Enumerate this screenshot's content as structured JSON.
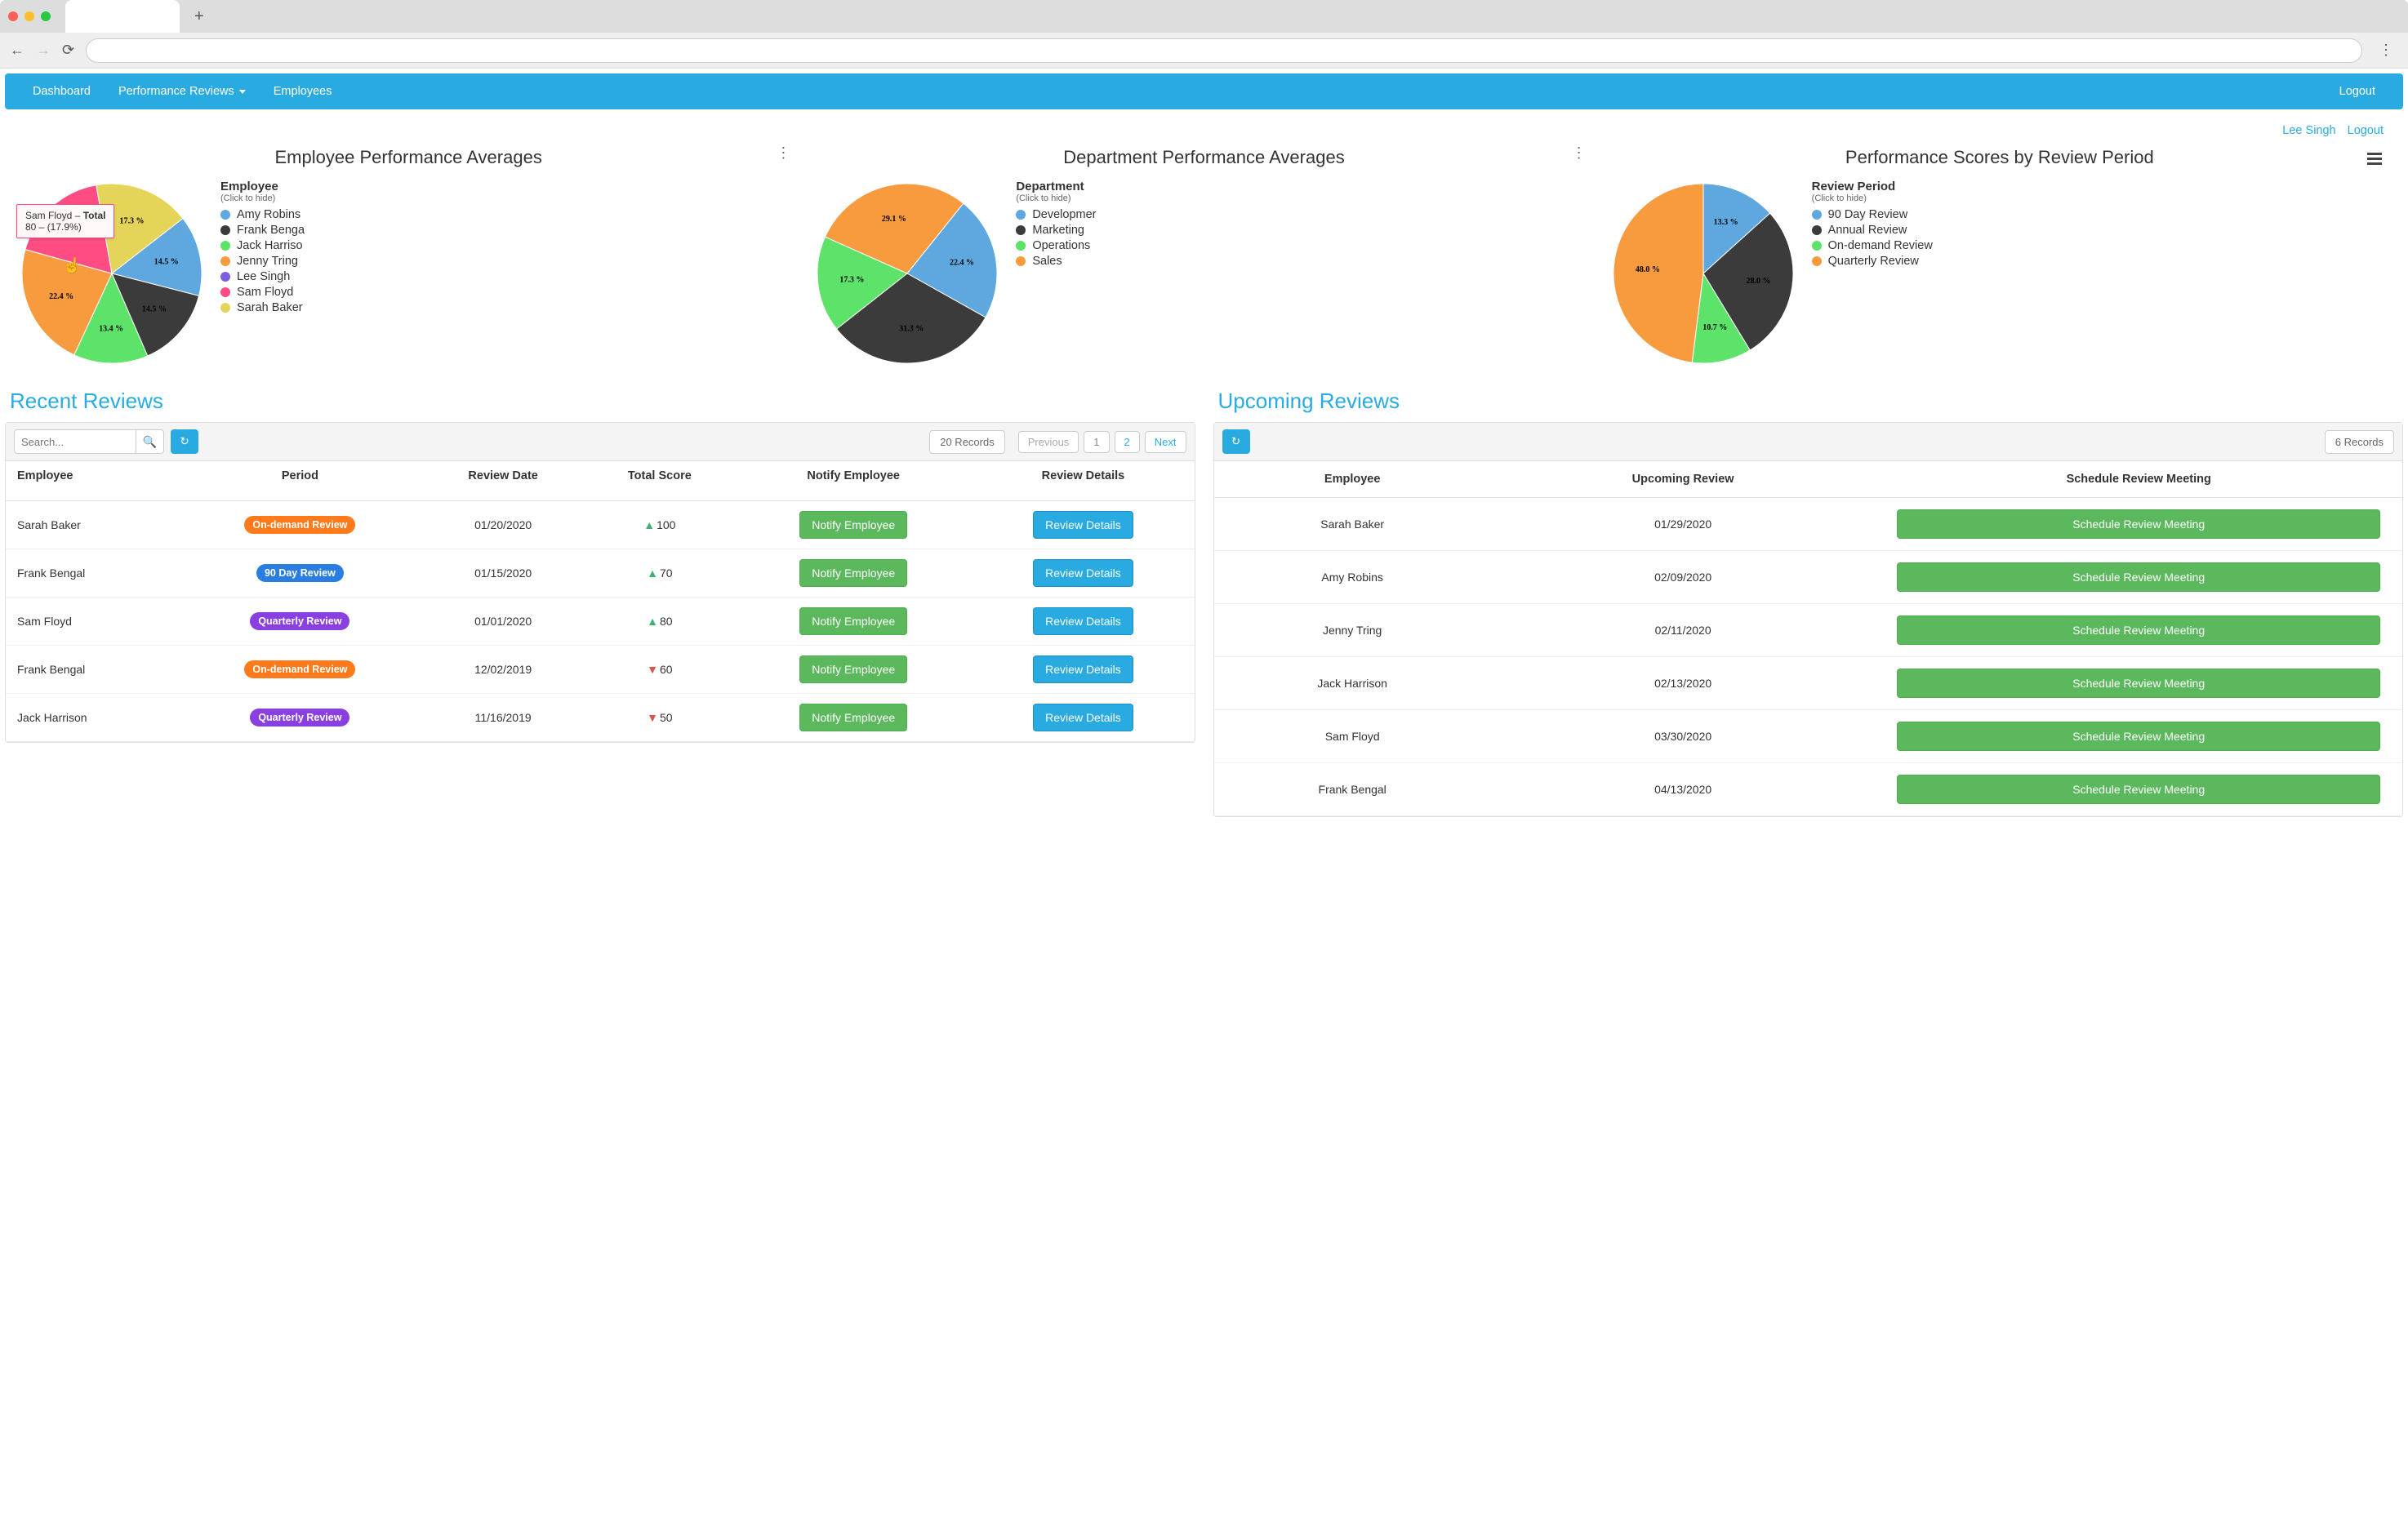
{
  "nav": {
    "items": [
      "Dashboard",
      "Performance Reviews",
      "Employees"
    ],
    "logout": "Logout"
  },
  "topLinks": {
    "user": "Lee Singh",
    "logout": "Logout"
  },
  "charts": [
    {
      "title": "Employee Performance Averages",
      "legendTitle": "Employee",
      "legendSub": "(Click to hide)",
      "tooltip": {
        "name": "Sam Floyd",
        "label": "Total",
        "value": "80 – (17.9%)"
      }
    },
    {
      "title": "Department Performance Averages",
      "legendTitle": "Department",
      "legendSub": "(Click to hide)"
    },
    {
      "title": "Performance Scores by Review Period",
      "legendTitle": "Review Period",
      "legendSub": "(Click to hide)"
    }
  ],
  "chart_data": [
    {
      "type": "pie",
      "title": "Employee Performance Averages",
      "series": [
        {
          "name": "Amy Robins",
          "value": 14.5,
          "color": "#5ea8df"
        },
        {
          "name": "Frank Benga",
          "value": 14.5,
          "color": "#3b3b3b"
        },
        {
          "name": "Jack Harriso",
          "value": 13.4,
          "color": "#5de26a"
        },
        {
          "name": "Jenny Tring",
          "value": 22.4,
          "color": "#f89b3f"
        },
        {
          "name": "Lee Singh",
          "value": 0.0,
          "color": "#7c5fe0"
        },
        {
          "name": "Sam Floyd",
          "value": 17.9,
          "color": "#ff4d84"
        },
        {
          "name": "Sarah Baker",
          "value": 17.3,
          "color": "#e5d45a"
        }
      ]
    },
    {
      "type": "pie",
      "title": "Department Performance Averages",
      "series": [
        {
          "name": "Developmer",
          "value": 22.4,
          "color": "#5ea8df"
        },
        {
          "name": "Marketing",
          "value": 31.3,
          "color": "#3b3b3b"
        },
        {
          "name": "Operations",
          "value": 17.3,
          "color": "#5de26a"
        },
        {
          "name": "Sales",
          "value": 29.1,
          "color": "#f89b3f"
        }
      ]
    },
    {
      "type": "pie",
      "title": "Performance Scores by Review Period",
      "series": [
        {
          "name": "90 Day Review",
          "value": 13.3,
          "color": "#5ea8df"
        },
        {
          "name": "Annual Review",
          "value": 28.0,
          "color": "#3b3b3b"
        },
        {
          "name": "On-demand Review",
          "value": 10.7,
          "color": "#5de26a"
        },
        {
          "name": "Quarterly Review",
          "value": 48.0,
          "color": "#f89b3f"
        }
      ]
    }
  ],
  "recent": {
    "title": "Recent Reviews",
    "searchPlaceholder": "Search...",
    "recordsLabel": "20 Records",
    "pager": {
      "prev": "Previous",
      "pages": [
        "1",
        "2"
      ],
      "next": "Next",
      "active": 0
    },
    "headers": [
      "Employee",
      "Period",
      "Review Date",
      "Total Score",
      "Notify Employee",
      "Review Details"
    ],
    "notifyLabel": "Notify Employee",
    "detailsLabel": "Review Details",
    "pillColors": {
      "On-demand Review": "#ff7a1a",
      "90 Day Review": "#2a7de1",
      "Quarterly Review": "#8a3fe0"
    },
    "rows": [
      {
        "employee": "Sarah Baker",
        "period": "On-demand Review",
        "date": "01/20/2020",
        "score": 100,
        "dir": "up"
      },
      {
        "employee": "Frank Bengal",
        "period": "90 Day Review",
        "date": "01/15/2020",
        "score": 70,
        "dir": "up"
      },
      {
        "employee": "Sam Floyd",
        "period": "Quarterly Review",
        "date": "01/01/2020",
        "score": 80,
        "dir": "up"
      },
      {
        "employee": "Frank Bengal",
        "period": "On-demand Review",
        "date": "12/02/2019",
        "score": 60,
        "dir": "down"
      },
      {
        "employee": "Jack Harrison",
        "period": "Quarterly Review",
        "date": "11/16/2019",
        "score": 50,
        "dir": "down"
      }
    ]
  },
  "upcoming": {
    "title": "Upcoming Reviews",
    "recordsLabel": "6 Records",
    "headers": [
      "Employee",
      "Upcoming Review",
      "Schedule Review Meeting"
    ],
    "buttonLabel": "Schedule Review Meeting",
    "rows": [
      {
        "employee": "Sarah Baker",
        "date": "01/29/2020"
      },
      {
        "employee": "Amy Robins",
        "date": "02/09/2020"
      },
      {
        "employee": "Jenny Tring",
        "date": "02/11/2020"
      },
      {
        "employee": "Jack Harrison",
        "date": "02/13/2020"
      },
      {
        "employee": "Sam Floyd",
        "date": "03/30/2020"
      },
      {
        "employee": "Frank Bengal",
        "date": "04/13/2020"
      }
    ]
  }
}
